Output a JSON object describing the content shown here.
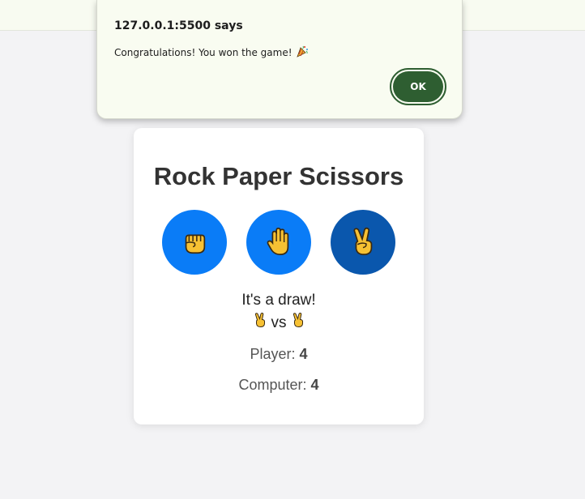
{
  "dialog": {
    "origin": "127.0.0.1:5500 says",
    "message": "Congratulations! You won the game!",
    "message_icon": "party-popper-icon",
    "ok_label": "OK"
  },
  "game": {
    "title": "Rock Paper Scissors",
    "choices": [
      {
        "name": "rock",
        "icon": "fist-icon"
      },
      {
        "name": "paper",
        "icon": "raised-hand-icon"
      },
      {
        "name": "scissors",
        "icon": "victory-hand-icon",
        "selected": true
      }
    ],
    "result_text": "It's a draw!",
    "player_icon": "victory-hand-icon",
    "vs_label": "vs",
    "computer_icon": "victory-hand-icon",
    "player_label": "Player: ",
    "player_score": "4",
    "computer_label": "Computer: ",
    "computer_score": "4"
  },
  "colors": {
    "choice_button": "#0a7cf7",
    "choice_selected": "#0a57ad",
    "ok_button": "#2e5e31",
    "emoji_skin": "#f7c133"
  }
}
